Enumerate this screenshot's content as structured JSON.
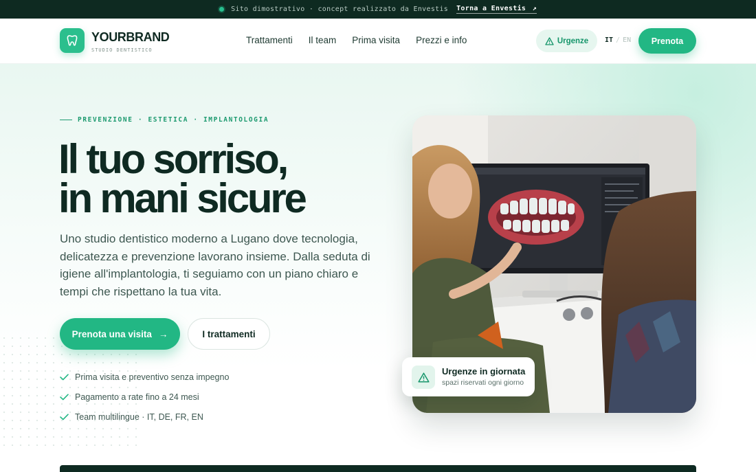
{
  "banner": {
    "text": "Sito dimostrativo · concept realizzato da Envestis",
    "link_label": "Torna a Envestis",
    "link_arrow": "↗"
  },
  "brand": {
    "name": "YOURBRAND",
    "subtitle": "STUDIO DENTISTICO",
    "icon": "tooth-icon"
  },
  "nav": {
    "items": [
      {
        "label": "Trattamenti"
      },
      {
        "label": "Il team"
      },
      {
        "label": "Prima visita"
      },
      {
        "label": "Prezzi e info"
      }
    ],
    "urgent_label": "Urgenze",
    "lang_active": "IT",
    "lang_sep": "/",
    "lang_other": "EN",
    "cta_label": "Prenota"
  },
  "hero": {
    "eyebrow": "PREVENZIONE · ESTETICA · IMPLANTOLOGIA",
    "headline_line1": "Il tuo sorriso,",
    "headline_line2": "in mani sicure",
    "lead": "Uno studio dentistico moderno a Lugano dove tecnologia, delicatezza e prevenzione lavorano insieme. Dalla seduta di igiene all'implantologia, ti seguiamo con un piano chiaro e tempi che rispettano la tua vita.",
    "primary_cta": "Prenota una visita",
    "primary_cta_arrow": "→",
    "secondary_cta": "I trattamenti",
    "features": [
      {
        "label": "Prima visita e preventivo senza impegno"
      },
      {
        "label": "Pagamento a rate fino a 24 mesi"
      },
      {
        "label": "Team multilingue · IT, DE, FR, EN"
      }
    ]
  },
  "urgent_card": {
    "title": "Urgenze in giornata",
    "subtitle": "spazi riservati ogni giorno"
  },
  "colors": {
    "brand_green": "#22b784",
    "dark": "#0e2a21",
    "mint_bg": "#e9f7f1"
  }
}
